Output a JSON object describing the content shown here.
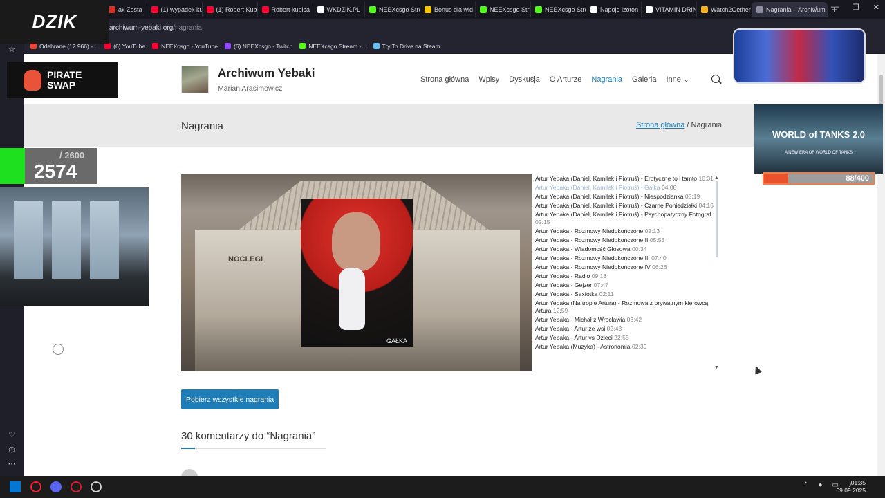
{
  "browser": {
    "tabs": [
      {
        "label": "ax Zosta",
        "color": "#d93025"
      },
      {
        "label": "(1) wypadek ku",
        "color": "#ff0033"
      },
      {
        "label": "(1) Robert Kub",
        "color": "#ff0033"
      },
      {
        "label": "Robert kubica",
        "color": "#ff0033"
      },
      {
        "label": "WKDZIK.PL",
        "color": "#ffffff"
      },
      {
        "label": "NEEXcsgo Stre",
        "color": "#53fc18"
      },
      {
        "label": "Bonus dla wid",
        "color": "#f5c400"
      },
      {
        "label": "NEEXcsgo Stre",
        "color": "#53fc18"
      },
      {
        "label": "NEEXcsgo Stre",
        "color": "#53fc18"
      },
      {
        "label": "Napoje izoton",
        "color": "#ffffff"
      },
      {
        "label": "VITAMIN DRIN",
        "color": "#ffffff"
      },
      {
        "label": "Watch2Gether",
        "color": "#f2b01e"
      },
      {
        "label": "Nagrania – Archiwum",
        "color": "#8d8fa0"
      }
    ],
    "new_tab": "+",
    "address": {
      "host": "archiwum-yebaki.org",
      "path": "/nagrania"
    },
    "bookmarks": [
      {
        "label": "Odebrane (12 966) -...",
        "color": "#ea4335"
      },
      {
        "label": "(6) YouTube",
        "color": "#ff0033"
      },
      {
        "label": "NEEXcsgo - YouTube",
        "color": "#ff0033"
      },
      {
        "label": "(6) NEEXcsgo - Twitch",
        "color": "#9146ff"
      },
      {
        "label": "NEEXcsgo Stream -...",
        "color": "#53fc18"
      },
      {
        "label": "Try To Drive na Steam",
        "color": "#66c0f4"
      }
    ]
  },
  "site": {
    "title": "Archiwum Yebaki",
    "subtitle": "Marian Arasimowicz",
    "nav": [
      "Strona główna",
      "Wpisy",
      "Dyskusja",
      "O Arturze",
      "Nagrania",
      "Galeria",
      "Inne"
    ],
    "nav_active": "Nagrania"
  },
  "page": {
    "heading": "Nagrania",
    "breadcrumb_home": "Strona główna",
    "breadcrumb_sep": " / ",
    "breadcrumb_current": "Nagrania",
    "poster_caption": "GAŁKA",
    "house_sign": "NOCLEGI",
    "download_label": "Pobierz wszystkie nagrania",
    "comments_heading": "30 komentarzy do “Nagrania”"
  },
  "playlist": [
    {
      "title": "Artur Yebaka (Daniel, Kamilek i Piotruś) - Erotyczne to i tamto",
      "duration": "10:31",
      "current": false
    },
    {
      "title": "Artur Yebaka (Daniel, Kamilek i Piotruś) - Gałka",
      "duration": "04:08",
      "current": true
    },
    {
      "title": "Artur Yebaka (Daniel, Kamilek i Piotruś) - Niespodzianka",
      "duration": "03:19",
      "current": false
    },
    {
      "title": "Artur Yebaka (Daniel, Kamilek i Piotruś) - Czarne Poniedziałki",
      "duration": "04:16",
      "current": false
    },
    {
      "title": "Artur Yebaka (Daniel, Kamilek i Piotruś) - Psychopatyczny Fotograf",
      "duration": "02:15",
      "current": false
    },
    {
      "title": "Artur Yebaka - Rozmowy Niedokończone",
      "duration": "02:13",
      "current": false
    },
    {
      "title": "Artur Yebaka - Rozmowy Niedokończone II",
      "duration": "05:53",
      "current": false
    },
    {
      "title": "Artur Yebaka - Wiadomość Głosowa",
      "duration": "00:34",
      "current": false
    },
    {
      "title": "Artur Yebaka - Rozmowy Niedokończone III",
      "duration": "07:40",
      "current": false
    },
    {
      "title": "Artur Yebaka - Rozmowy Niedokończone IV",
      "duration": "06:26",
      "current": false
    },
    {
      "title": "Artur Yebaka - Radio",
      "duration": "09:18",
      "current": false
    },
    {
      "title": "Artur Yebaka - Gejzer",
      "duration": "07:47",
      "current": false
    },
    {
      "title": "Artur Yebaka - Sexfotka",
      "duration": "02:11",
      "current": false
    },
    {
      "title": "Artur Yebaka (Na tropie Artura) - Rozmowa z prywatnym kierowcą Artura",
      "duration": "12:59",
      "current": false
    },
    {
      "title": "Artur Yebaka - Michał z Wrocławia",
      "duration": "03:42",
      "current": false
    },
    {
      "title": "Artur Yebaka - Artur ze wsi",
      "duration": "02:43",
      "current": false
    },
    {
      "title": "Artur Yebaka - Artur vs Dzieci",
      "duration": "22:55",
      "current": false
    },
    {
      "title": "Artur Yebaka (Muzyka) - Astronomia",
      "duration": "02:39",
      "current": false
    }
  ],
  "overlays": {
    "dzik_logo": "DZIK",
    "pirate_swap": [
      "PIRATE",
      "SWAP"
    ],
    "counter_goal": "/ 2600",
    "counter_value": "2574",
    "wot_title": "WORLD of TANKS",
    "wot_version": "2.0",
    "wot_tagline": "A NEW ERA OF WORLD OF TANKS",
    "wot_progress_label": "88/400",
    "wot_progress": 0.22
  },
  "taskbar": {
    "time": "01:35",
    "date": "09.09.2025"
  }
}
